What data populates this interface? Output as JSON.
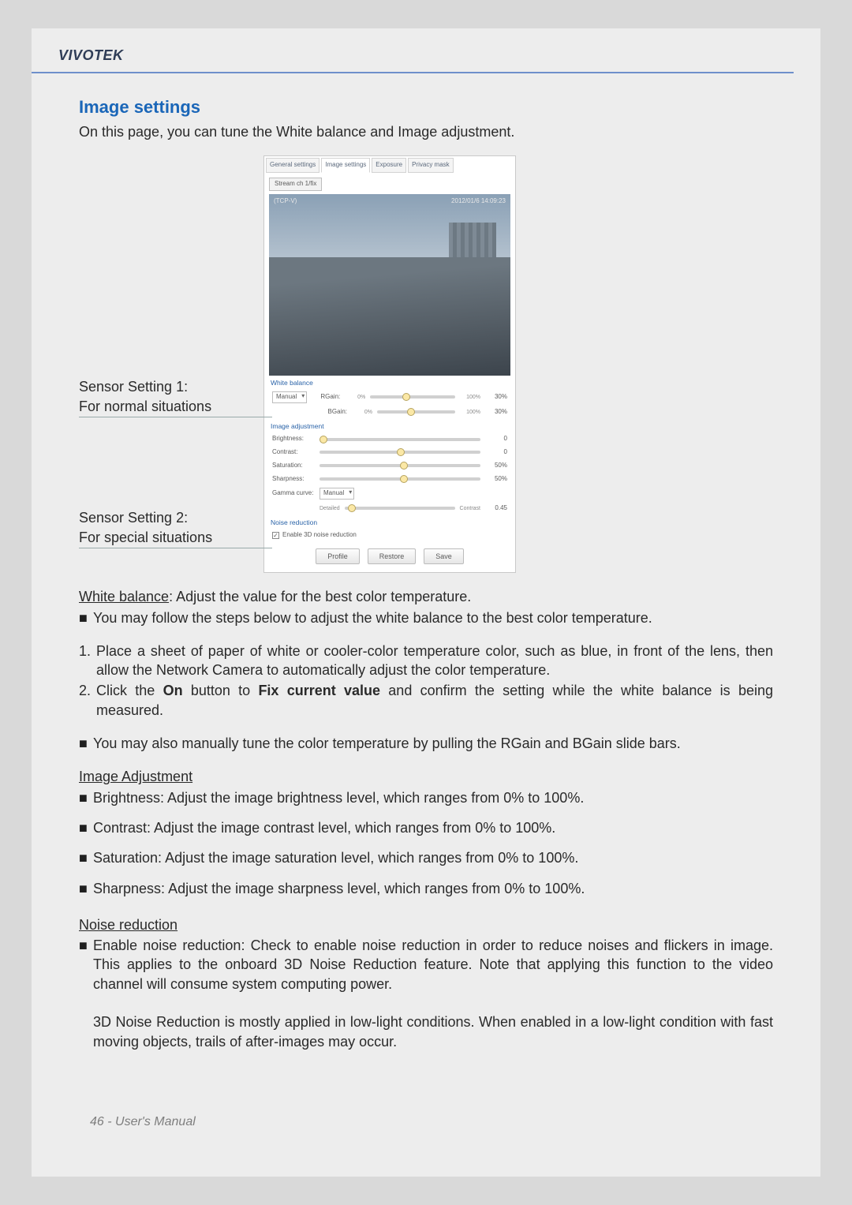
{
  "brand": "VIVOTEK",
  "section_title": "Image settings",
  "intro": "On this page, you can tune the White balance and Image adjustment.",
  "figure_labels": {
    "setting1_line1": "Sensor Setting 1:",
    "setting1_line2": "For normal situations",
    "setting2_line1": "Sensor Setting 2:",
    "setting2_line2": "For special situations"
  },
  "panel": {
    "tabs": [
      "General settings",
      "Image settings",
      "Exposure",
      "Privacy mask"
    ],
    "stream_chip": "Stream ch 1/fix",
    "preview_tl": "(TCP-V)",
    "preview_tr": "2012/01/6 14:09:23",
    "sections": {
      "white_balance": {
        "title": "White balance",
        "mode_label": "Manual",
        "rgain_label": "RGain:",
        "rgain_min": "0%",
        "rgain_max": "100%",
        "rgain_val": "30%",
        "bgain_label": "BGain:",
        "bgain_min": "0%",
        "bgain_max": "100%",
        "bgain_val": "30%"
      },
      "image_adjustment": {
        "title": "Image adjustment",
        "brightness_label": "Brightness:",
        "brightness_val": "0",
        "contrast_label": "Contrast:",
        "contrast_val": "0",
        "saturation_label": "Saturation:",
        "saturation_val": "50%",
        "sharpness_label": "Sharpness:",
        "sharpness_val": "50%",
        "gamma_label": "Gamma curve:",
        "gamma_mode": "Manual",
        "gamma_detail": "Detailed",
        "gamma_contrast": "Contrast",
        "gamma_val": "0.45"
      },
      "noise_reduction": {
        "title": "Noise reduction",
        "checkbox_label": "Enable 3D noise reduction"
      }
    },
    "buttons": {
      "profile": "Profile",
      "restore": "Restore",
      "save": "Save"
    }
  },
  "body": {
    "wb_heading": "White balance",
    "wb_heading_rest": ": Adjust the value for the best color temperature.",
    "wb_bullet1": "You may follow the steps below to adjust the white balance to the best color temperature.",
    "step1": "Place a sheet of paper of white or cooler-color temperature color, such as blue, in front of the lens, then allow the Network Camera to automatically adjust the color temperature.",
    "step2_pre": "Click the ",
    "step2_on": "On",
    "step2_mid": " button to ",
    "step2_fix": "Fix current value",
    "step2_post": " and confirm the setting while the white balance is being measured.",
    "wb_bullet2": "You may also manually tune the color temperature by pulling the RGain and BGain slide bars.",
    "ia_heading": "Image Adjustment",
    "ia_b1": "Brightness: Adjust the image brightness level, which ranges from 0% to 100%.",
    "ia_b2": "Contrast: Adjust the image contrast level, which ranges from 0% to 100%.",
    "ia_b3": "Saturation: Adjust the image saturation level, which ranges from 0% to 100%.",
    "ia_b4": "Sharpness: Adjust the image sharpness level, which ranges from 0% to 100%.",
    "nr_heading": "Noise reduction",
    "nr_p1": "Enable noise reduction: Check to enable noise reduction in order to reduce noises and flickers in image. This applies to the onboard 3D Noise Reduction feature. Note that applying this function to the video channel will consume system computing power.",
    "nr_p2": "3D Noise Reduction is mostly applied in low-light conditions. When enabled in a low-light condition with fast moving objects, trails of after-images may occur."
  },
  "footer": "46 - User's Manual"
}
